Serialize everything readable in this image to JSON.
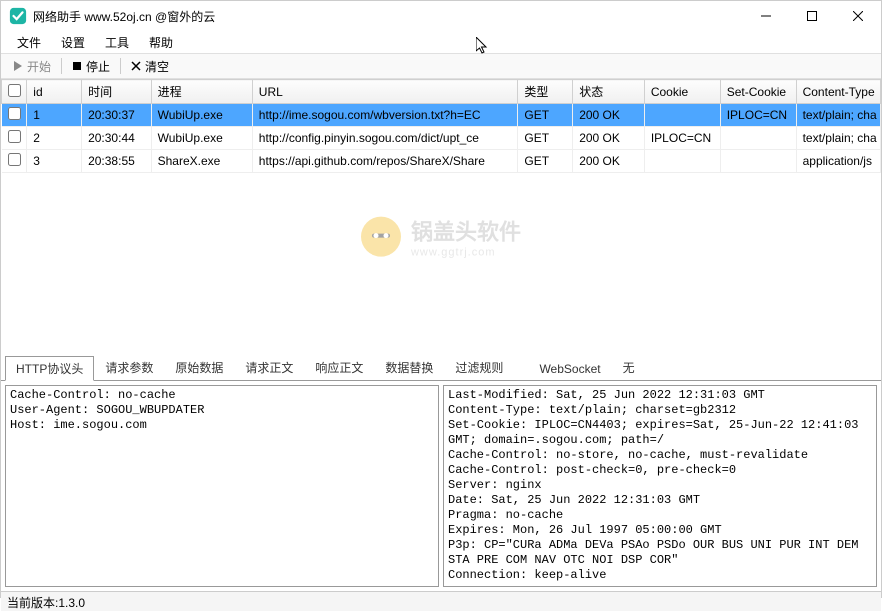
{
  "window": {
    "title": "网络助手  www.52oj.cn @窗外的云"
  },
  "menu": {
    "file": "文件",
    "settings": "设置",
    "tools": "工具",
    "help": "帮助"
  },
  "toolbar": {
    "start": "开始",
    "stop": "停止",
    "clear": "清空"
  },
  "grid": {
    "headers": {
      "id": "id",
      "time": "时间",
      "proc": "进程",
      "url": "URL",
      "type": "类型",
      "status": "状态",
      "cookie": "Cookie",
      "setcookie": "Set-Cookie",
      "ctype": "Content-Type"
    },
    "rows": [
      {
        "id": "1",
        "time": "20:30:37",
        "proc": "WubiUp.exe",
        "url": "http://ime.sogou.com/wbversion.txt?h=EC",
        "type": "GET",
        "status": "200 OK",
        "cookie": "",
        "setcookie": "IPLOC=CN",
        "ctype": "text/plain; cha",
        "selected": true
      },
      {
        "id": "2",
        "time": "20:30:44",
        "proc": "WubiUp.exe",
        "url": "http://config.pinyin.sogou.com/dict/upt_ce",
        "type": "GET",
        "status": "200 OK",
        "cookie": "IPLOC=CN",
        "setcookie": "",
        "ctype": "text/plain; cha",
        "selected": false
      },
      {
        "id": "3",
        "time": "20:38:55",
        "proc": "ShareX.exe",
        "url": "https://api.github.com/repos/ShareX/Share",
        "type": "GET",
        "status": "200 OK",
        "cookie": "",
        "setcookie": "",
        "ctype": "application/js",
        "selected": false
      }
    ]
  },
  "watermark": {
    "big": "锅盖头软件",
    "small": "www.ggtrj.com"
  },
  "tabs": {
    "t1": "HTTP协议头",
    "t2": "请求参数",
    "t3": "原始数据",
    "t4": "请求正文",
    "t5": "响应正文",
    "t6": "数据替换",
    "t7": "过滤规则",
    "ws": "WebSocket",
    "none": "无"
  },
  "panels": {
    "left": "Cache-Control: no-cache\nUser-Agent: SOGOU_WBUPDATER\nHost: ime.sogou.com",
    "right": "Last-Modified: Sat, 25 Jun 2022 12:31:03 GMT\nContent-Type: text/plain; charset=gb2312\nSet-Cookie: IPLOC=CN4403; expires=Sat, 25-Jun-22 12:41:03 GMT; domain=.sogou.com; path=/\nCache-Control: no-store, no-cache, must-revalidate\nCache-Control: post-check=0, pre-check=0\nServer: nginx\nDate: Sat, 25 Jun 2022 12:31:03 GMT\nPragma: no-cache\nExpires: Mon, 26 Jul 1997 05:00:00 GMT\nP3p: CP=\"CURa ADMa DEVa PSAo PSDo OUR BUS UNI PUR INT DEM STA PRE COM NAV OTC NOI DSP COR\"\nConnection: keep-alive"
  },
  "status": {
    "version": "当前版本:1.3.0"
  }
}
